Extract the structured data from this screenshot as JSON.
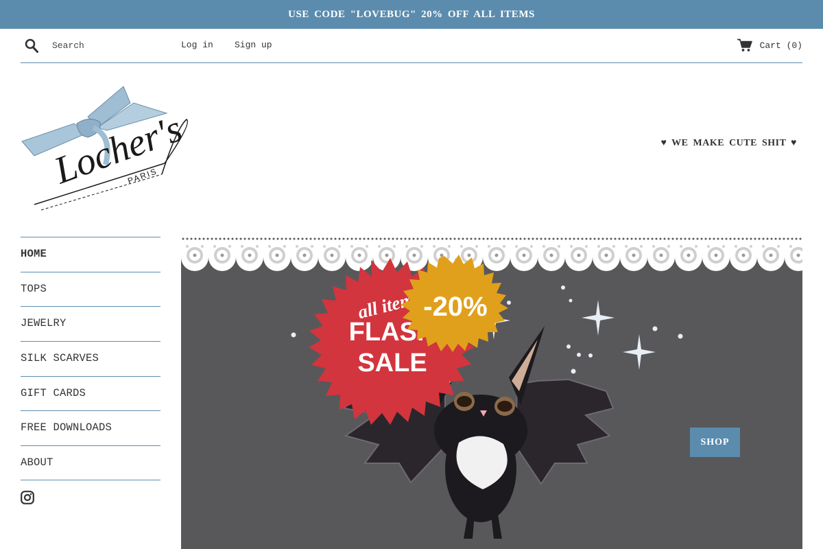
{
  "announcement": "USE CODE \"LOVEBUG\" 20% OFF ALL ITEMS",
  "header": {
    "search_placeholder": "Search",
    "login": "Log in",
    "signup": "Sign up",
    "cart": "Cart (0)"
  },
  "logo": {
    "script": "Locher's",
    "sub": "PARIS"
  },
  "tagline": "♥ WE MAKE CUTE SHIT ♥",
  "nav": {
    "items": [
      {
        "label": "HOME"
      },
      {
        "label": "TOPS"
      },
      {
        "label": "JEWELRY"
      },
      {
        "label": "SILK SCARVES"
      },
      {
        "label": "GIFT CARDS"
      },
      {
        "label": "FREE DOWNLOADS"
      },
      {
        "label": "ABOUT"
      }
    ]
  },
  "hero": {
    "badge_line1": "all items",
    "badge_line2": "FLASH",
    "badge_line3": "SALE",
    "discount": "-20%",
    "shop_button": "SHOP"
  },
  "colors": {
    "accent": "#5b8cae",
    "sale_red": "#d2353d",
    "discount_gold": "#e0a01c",
    "fabric": "#58585a"
  }
}
